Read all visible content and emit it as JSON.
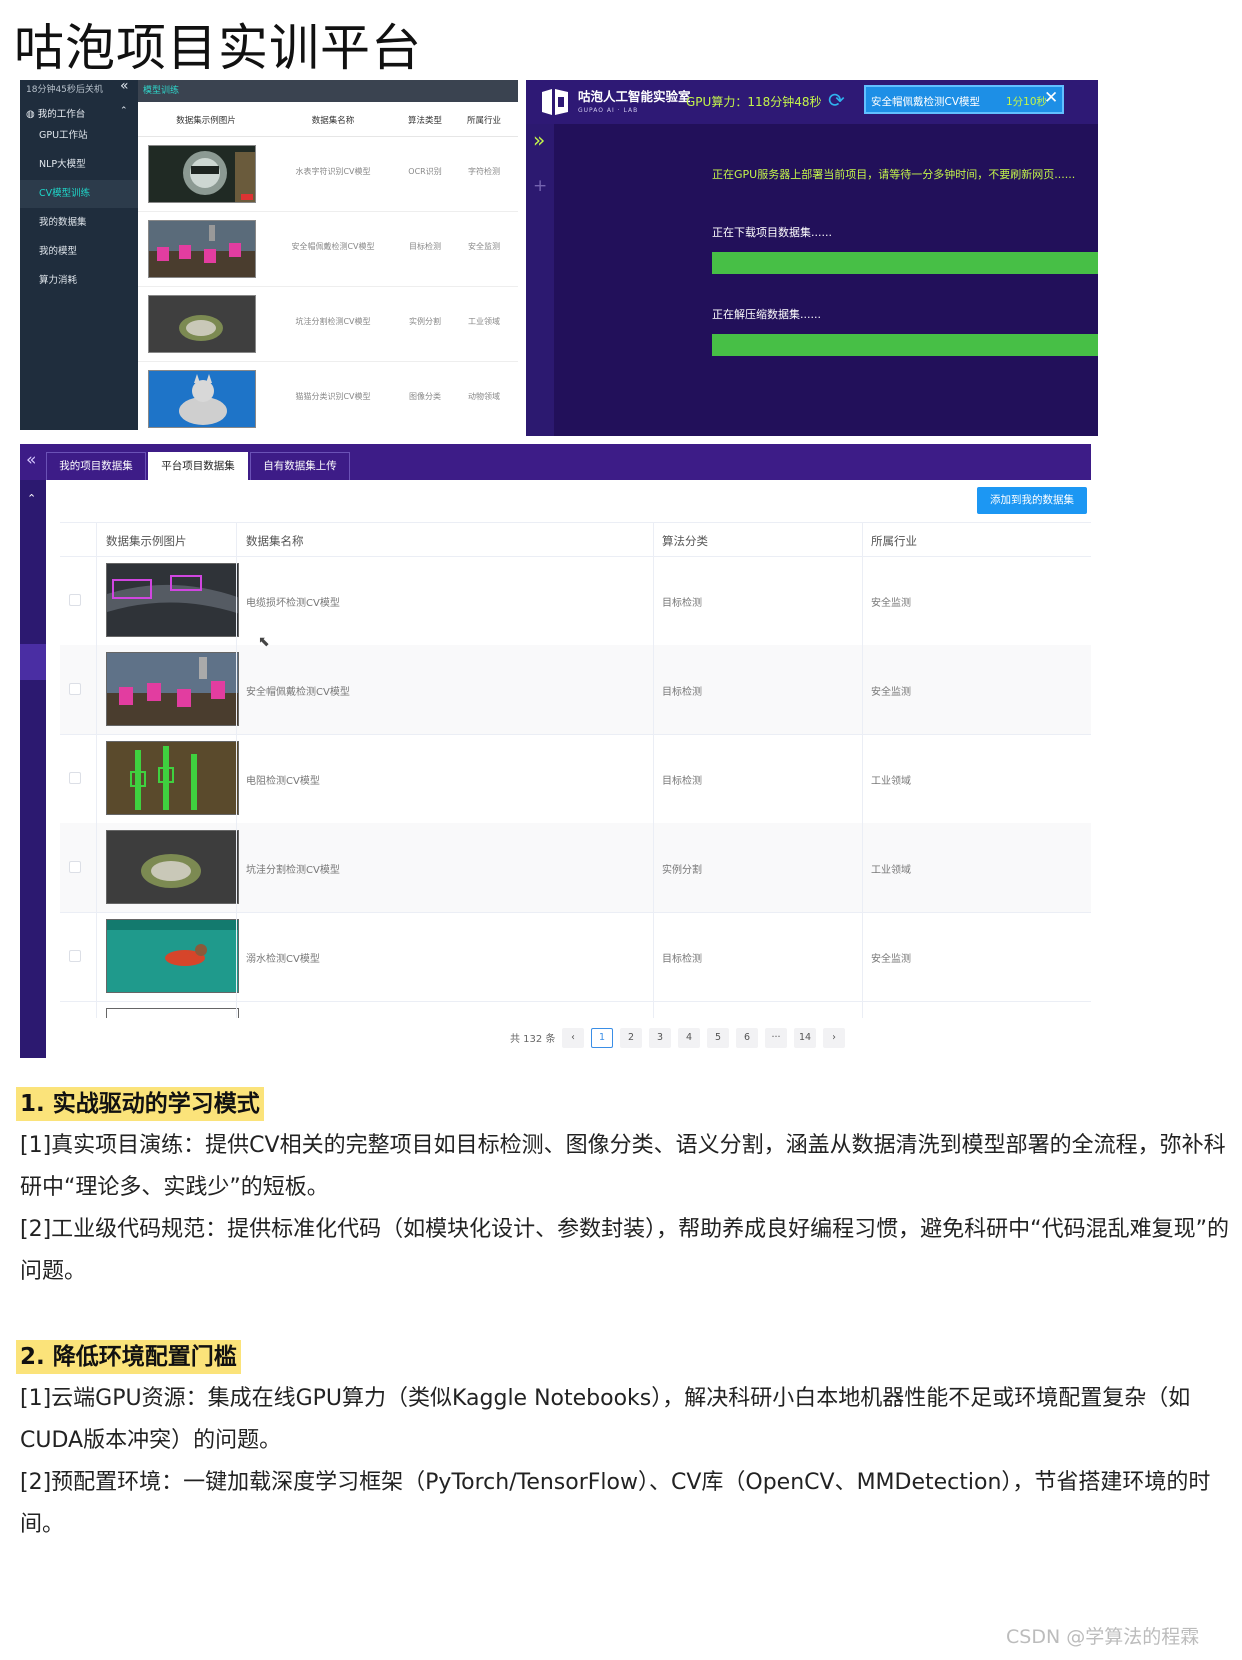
{
  "page": {
    "title": "咕泡项目实训平台"
  },
  "panel_a": {
    "timer": "18分钟45秒后关机",
    "collapse_icon": "«",
    "group": {
      "label": "我的工作台",
      "icon": "◍",
      "chevron": "⌃"
    },
    "nav": [
      {
        "label": "GPU工作站",
        "active": false
      },
      {
        "label": "NLP大模型",
        "active": false
      },
      {
        "label": "CV模型训练",
        "active": true
      },
      {
        "label": "我的数据集",
        "active": false
      },
      {
        "label": "我的模型",
        "active": false
      },
      {
        "label": "算力消耗",
        "active": false
      }
    ],
    "topbar_title": "模型训练",
    "columns": [
      "数据集示例图片",
      "数据集名称",
      "算法类型",
      "所属行业"
    ],
    "rows": [
      {
        "name": "水表字符识别CV模型",
        "algo": "OCR识别",
        "industry": "字符检测",
        "thumb": "water-meter-icon"
      },
      {
        "name": "安全帽佩戴检测CV模型",
        "algo": "目标检测",
        "industry": "安全监测",
        "thumb": "helmet-workers-icon"
      },
      {
        "name": "坑洼分割检测CV模型",
        "algo": "实例分割",
        "industry": "工业领域",
        "thumb": "pothole-icon"
      },
      {
        "name": "猫猫分类识别CV模型",
        "algo": "图像分类",
        "industry": "动物领域",
        "thumb": "cat-icon"
      }
    ]
  },
  "panel_b": {
    "logo": {
      "name": "咕泡人工智能实验室",
      "sub": "GUPAO AI · LAB"
    },
    "gpu": "GPU算力：118分钟48秒",
    "refresh_icon": "⟳",
    "task": {
      "name": "安全帽佩戴检测CV模型",
      "timer": "1分10秒",
      "close": "✕"
    },
    "expand_icon": "»",
    "plus_icon": "+",
    "message": "正在GPU服务器上部署当前项目，请等待一分多钟时间，不要刷新网页......",
    "steps": [
      {
        "label": "正在下载项目数据集......",
        "progress": 1.0
      },
      {
        "label": "正在解压缩数据集......",
        "progress": 1.0
      }
    ],
    "colors": {
      "background": "#22105a",
      "accent": "#c4f54a",
      "progress": "#47bf46"
    }
  },
  "panel_c": {
    "collapse_icon": "«",
    "side_chevron": "⌃",
    "tabs": [
      {
        "label": "我的项目数据集",
        "active": false
      },
      {
        "label": "平台项目数据集",
        "active": true
      },
      {
        "label": "自有数据集上传",
        "active": false
      }
    ],
    "add_button": "添加到我的数据集",
    "columns": [
      "数据集示例图片",
      "数据集名称",
      "算法分类",
      "所属行业"
    ],
    "rows": [
      {
        "name": "电缆损坏检测CV模型",
        "algo": "目标检测",
        "industry": "安全监测",
        "thumb": "cable-damage-icon"
      },
      {
        "name": "安全帽佩戴检测CV模型",
        "algo": "目标检测",
        "industry": "安全监测",
        "thumb": "helmet-workers-icon"
      },
      {
        "name": "电阻检测CV模型",
        "algo": "目标检测",
        "industry": "工业领域",
        "thumb": "resistor-icon"
      },
      {
        "name": "坑洼分割检测CV模型",
        "algo": "实例分割",
        "industry": "工业领域",
        "thumb": "pothole-icon"
      },
      {
        "name": "溺水检测CV模型",
        "algo": "目标检测",
        "industry": "安全监测",
        "thumb": "drowning-icon"
      }
    ],
    "pagination": {
      "total": "共 132 条",
      "prev": "‹",
      "next": "›",
      "pages": [
        "1",
        "2",
        "3",
        "4",
        "5",
        "6",
        "···",
        "14"
      ],
      "current": "1"
    },
    "cursor_icon": "⬉"
  },
  "article": {
    "section1": {
      "title": "1. 实战驱动的学习模式",
      "p1": "[1]真实项目演练：提供CV相关的完整项目如目标检测、图像分类、语义分割，涵盖从数据清洗到模型部署的全流程，弥补科研中“理论多、实践少”的短板。",
      "p2": "[2]工业级代码规范：提供标准化代码（如模块化设计、参数封装），帮助养成良好编程习惯，避免科研中“代码混乱难复现”的问题。"
    },
    "section2": {
      "title": "2. 降低环境配置门槛",
      "p1": "[1]云端GPU资源：集成在线GPU算力（类似Kaggle Notebooks），解决科研小白本地机器性能不足或环境配置复杂（如CUDA版本冲突）的问题。",
      "p2": "[2]预配置环境：一键加载深度学习框架（PyTorch/TensorFlow）、CV库（OpenCV、MMDetection），节省搭建环境的时间。"
    }
  },
  "watermark": "CSDN @学算法的程霖"
}
